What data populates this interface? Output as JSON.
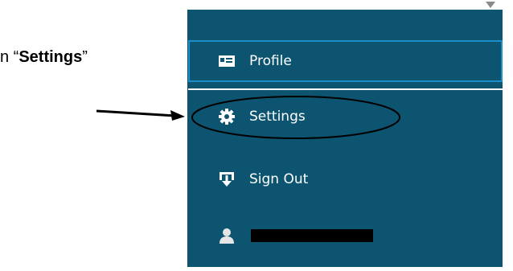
{
  "instruction": {
    "prefix": "n “",
    "bold": "Settings",
    "suffix": "”"
  },
  "menu": {
    "items": [
      {
        "label": "Profile",
        "icon": "id-card-icon"
      },
      {
        "label": "Settings",
        "icon": "gear-icon"
      },
      {
        "label": "Sign Out",
        "icon": "sign-out-icon"
      },
      {
        "label": "",
        "icon": "user-icon",
        "redacted": true
      }
    ]
  },
  "colors": {
    "menu_bg": "#0c5470",
    "active_border": "#1c8fc8",
    "text": "#ffffff"
  }
}
